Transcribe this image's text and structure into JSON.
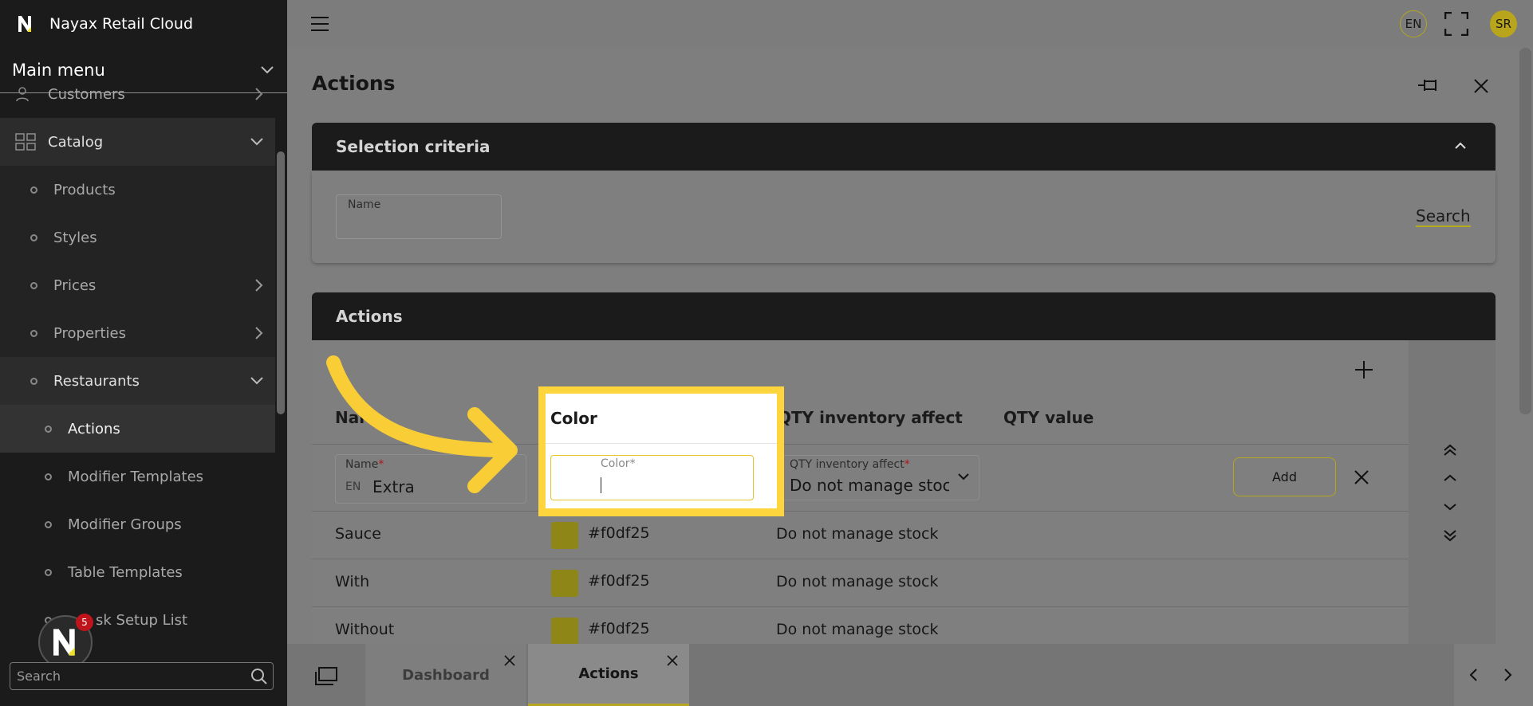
{
  "app": {
    "title": "Nayax Retail Cloud"
  },
  "sidebar": {
    "main_menu_label": "Main menu",
    "items": [
      {
        "label": "Customers"
      },
      {
        "label": "Catalog"
      },
      {
        "label": "Products"
      },
      {
        "label": "Styles"
      },
      {
        "label": "Prices"
      },
      {
        "label": "Properties"
      },
      {
        "label": "Restaurants"
      },
      {
        "label": "Actions"
      },
      {
        "label": "Modifier Templates"
      },
      {
        "label": "Modifier Groups"
      },
      {
        "label": "Table Templates"
      },
      {
        "label": "Kiosk Setup List",
        "visible_text": "sk Setup List"
      }
    ],
    "search_placeholder": "Search",
    "notification_count": "5"
  },
  "topbar": {
    "lang": "EN",
    "user_initials": "SR"
  },
  "page": {
    "title": "Actions"
  },
  "criteria": {
    "title": "Selection criteria",
    "name_label": "Name",
    "search_label": "Search"
  },
  "actions_panel": {
    "title": "Actions",
    "columns": {
      "name": "Name",
      "name_visible": "Nai",
      "color": "Color",
      "qty_affect": "QTY inventory affect",
      "qty_value": "QTY value"
    },
    "new_row": {
      "name_label": "Name",
      "required_mark": "*",
      "lang": "EN",
      "name_value": "Extra",
      "color_label": "Color",
      "qty_label": "QTY inventory affect",
      "qty_value": "Do not manage stoc",
      "add_label": "Add"
    },
    "rows": [
      {
        "name": "Sauce",
        "color": "#f0df25",
        "qty_affect": "Do not manage stock"
      },
      {
        "name": "With",
        "color": "#f0df25",
        "qty_affect": "Do not manage stock"
      },
      {
        "name": "Without",
        "color": "#f0df25",
        "qty_affect": "Do not manage stock"
      }
    ]
  },
  "tabs": [
    {
      "label": "Dashboard"
    },
    {
      "label": "Actions"
    }
  ],
  "colors": {
    "highlight": "#ffd53e",
    "accent": "#f0df25",
    "sidebar": "#1b1b1b"
  }
}
